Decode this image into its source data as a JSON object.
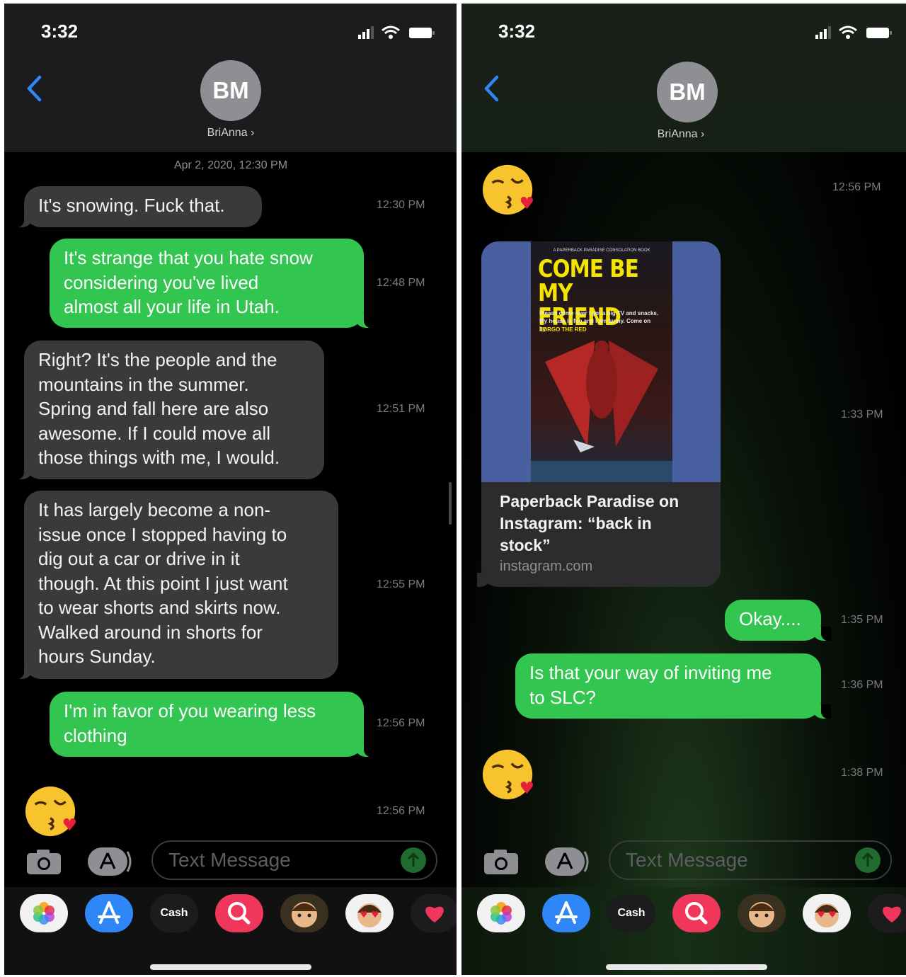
{
  "left": {
    "status_time": "3:32",
    "contact": {
      "initials": "BM",
      "name": "BriAnna ›"
    },
    "date_separator": "Apr 2, 2020, 12:30 PM",
    "messages": [
      {
        "text": "It's snowing. Fuck that.",
        "time": "12:30 PM"
      },
      {
        "text": "It's strange that you hate snow\nconsidering you've lived\nalmost all your life in Utah.",
        "time": "12:48 PM"
      },
      {
        "text": "Right? It's the people and the\nmountains in the summer.\nSpring and fall here are also\nawesome. If I could move all\nthose things with me, I would.",
        "time": "12:51 PM"
      },
      {
        "text": "It has largely become a non-\nissue once I stopped having to\ndig out a car or drive in it\nthough. At this point I just want\nto wear shorts and skirts now.\nWalked around in shorts for\nhours Sunday.",
        "time": "12:55 PM"
      },
      {
        "text": "I'm in favor of you wearing less\nclothing",
        "time": "12:56 PM"
      },
      {
        "emoji": "face-blowing-a-kiss",
        "time": "12:56 PM"
      }
    ],
    "compose_placeholder": "Text Message"
  },
  "right": {
    "status_time": "3:32",
    "contact": {
      "initials": "BM",
      "name": "BriAnna ›"
    },
    "messages": [
      {
        "emoji": "face-blowing-a-kiss",
        "time": "12:56 PM"
      },
      {
        "link": {
          "book_series": "A PAPERBACK PARADISE CONSOLATION BOOK",
          "book_title": "COME BE MY FRIEND",
          "book_blurb": "Please come over I got a big TV and snacks. My house is fun and I am funny. Come on by.",
          "book_author": "ZORGO THE RED",
          "title": "Paperback Paradise on Instagram: “back in stock”",
          "domain": "instagram.com"
        },
        "time": "1:33 PM"
      },
      {
        "text": "Okay....",
        "time": "1:35 PM"
      },
      {
        "text": "Is that your way of inviting me\nto SLC?",
        "time": "1:36 PM"
      },
      {
        "emoji": "face-blowing-a-kiss",
        "time": "1:38 PM"
      }
    ],
    "compose_placeholder": "Text Message"
  },
  "app_drawer": [
    {
      "icon": "photos-icon"
    },
    {
      "icon": "app-store-icon"
    },
    {
      "icon": "apple-cash-icon",
      "label": "Cash"
    },
    {
      "icon": "image-search-icon"
    },
    {
      "icon": "memoji-icon"
    },
    {
      "icon": "memoji-stickers-icon"
    },
    {
      "icon": "digital-touch-icon"
    }
  ],
  "colors": {
    "outgoing": "#32c650",
    "incoming": "#3a3a3c",
    "accent": "#2f86f6"
  }
}
